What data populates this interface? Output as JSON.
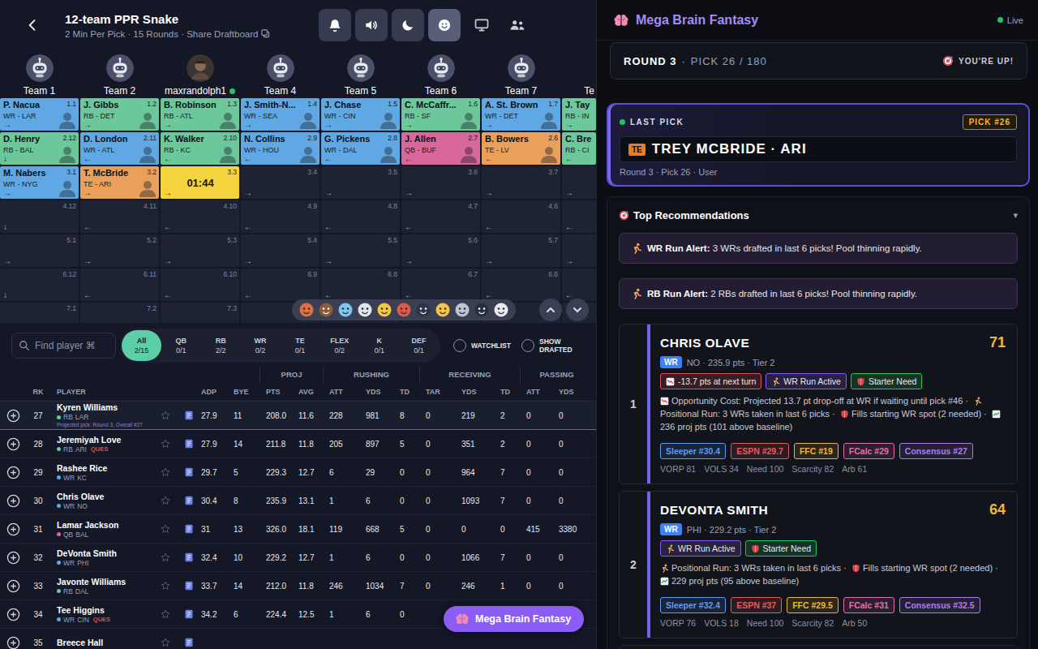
{
  "header": {
    "title": "12-team PPR Snake",
    "subtitle": "2 Min Per Pick · 15 Rounds · Share Draftboard"
  },
  "toolbar": [
    {
      "kind": "bell",
      "selected": false
    },
    {
      "kind": "speaker",
      "selected": false
    },
    {
      "kind": "moon",
      "selected": false
    },
    {
      "kind": "smile",
      "selected": true
    }
  ],
  "teams": [
    {
      "label": "Team 1",
      "kind": "bot"
    },
    {
      "label": "Team 2",
      "kind": "bot"
    },
    {
      "label": "maxrandolph1",
      "kind": "user",
      "online": true
    },
    {
      "label": "Team 4",
      "kind": "bot"
    },
    {
      "label": "Team 5",
      "kind": "bot"
    },
    {
      "label": "Team 6",
      "kind": "bot"
    },
    {
      "label": "Team 7",
      "kind": "bot"
    },
    {
      "label": "Te",
      "kind": "bot"
    }
  ],
  "board": {
    "rows": [
      [
        {
          "kind": "picked",
          "name": "P. Nacua",
          "pick": "1.1",
          "pos": "WR - LAR",
          "color": "#5fa8e3",
          "arrow": "→"
        },
        {
          "kind": "picked",
          "name": "J. Gibbs",
          "pick": "1.2",
          "pos": "RB - DET",
          "color": "#6cc89a",
          "arrow": "→"
        },
        {
          "kind": "picked",
          "name": "B. Robinson",
          "pick": "1.3",
          "pos": "RB - ATL",
          "color": "#6cc89a",
          "arrow": "→"
        },
        {
          "kind": "picked",
          "name": "J. Smith-N...",
          "pick": "1.4",
          "pos": "WR - SEA",
          "color": "#5fa8e3",
          "arrow": "→"
        },
        {
          "kind": "picked",
          "name": "J. Chase",
          "pick": "1.5",
          "pos": "WR - CIN",
          "color": "#5fa8e3",
          "arrow": "→"
        },
        {
          "kind": "picked",
          "name": "C. McCaffr...",
          "pick": "1.6",
          "pos": "RB - SF",
          "color": "#6cc89a",
          "arrow": "→"
        },
        {
          "kind": "picked",
          "name": "A. St. Brown",
          "pick": "1.7",
          "pos": "WR - DET",
          "color": "#5fa8e3",
          "arrow": "→"
        },
        {
          "kind": "picked",
          "name": "J. Tay",
          "pos": "RB - IN",
          "color": "#6cc89a",
          "arrow": "→"
        }
      ],
      [
        {
          "kind": "picked",
          "name": "D. Henry",
          "pick": "2.12",
          "pos": "RB - BAL",
          "color": "#6cc89a",
          "arrow": "↓"
        },
        {
          "kind": "picked",
          "name": "D. London",
          "pick": "2.11",
          "pos": "WR - ATL",
          "color": "#5fa8e3",
          "arrow": "←"
        },
        {
          "kind": "picked",
          "name": "K. Walker",
          "pick": "2.10",
          "pos": "RB - KC",
          "color": "#6cc89a",
          "arrow": "←"
        },
        {
          "kind": "picked",
          "name": "N. Collins",
          "pick": "2.9",
          "pos": "WR - HOU",
          "color": "#5fa8e3",
          "arrow": "←"
        },
        {
          "kind": "picked",
          "name": "G. Pickens",
          "pick": "2.8",
          "pos": "WR - DAL",
          "color": "#5fa8e3",
          "arrow": "←"
        },
        {
          "kind": "picked",
          "name": "J. Allen",
          "pick": "2.7",
          "pos": "QB - BUF",
          "color": "#d8679a",
          "arrow": "←"
        },
        {
          "kind": "picked",
          "name": "B. Bowers",
          "pick": "2.6",
          "pos": "TE - LV",
          "color": "#e9a05b",
          "arrow": "←"
        },
        {
          "kind": "picked",
          "name": "C. Bre",
          "pos": "RB - CI",
          "color": "#6cc89a",
          "arrow": "←"
        }
      ],
      [
        {
          "kind": "picked",
          "name": "M. Nabers",
          "pick": "3.1",
          "pos": "WR - NYG",
          "color": "#5fa8e3",
          "arrow": "→"
        },
        {
          "kind": "picked",
          "name": "T. McBride",
          "pick": "3.2",
          "pos": "TE - ARI",
          "color": "#e9a05b",
          "arrow": "→"
        },
        {
          "kind": "current",
          "pick": "3.3",
          "timer": "01:44",
          "arrow": "→"
        },
        {
          "kind": "empty",
          "pick": "3.4",
          "arrow": "→"
        },
        {
          "kind": "empty",
          "pick": "3.5",
          "arrow": "→"
        },
        {
          "kind": "empty",
          "pick": "3.6",
          "arrow": "→"
        },
        {
          "kind": "empty",
          "pick": "3.7",
          "arrow": "→"
        },
        {
          "kind": "empty",
          "arrow": "→"
        }
      ],
      [
        {
          "kind": "empty",
          "pick": "4.12",
          "arrow": "↓"
        },
        {
          "kind": "empty",
          "pick": "4.11",
          "arrow": "←"
        },
        {
          "kind": "empty",
          "pick": "4.10",
          "arrow": "←"
        },
        {
          "kind": "empty",
          "pick": "4.9",
          "arrow": "←"
        },
        {
          "kind": "empty",
          "pick": "4.8",
          "arrow": "←"
        },
        {
          "kind": "empty",
          "pick": "4.7",
          "arrow": "←"
        },
        {
          "kind": "empty",
          "pick": "4.6",
          "arrow": "←"
        },
        {
          "kind": "empty",
          "arrow": "←"
        }
      ],
      [
        {
          "kind": "empty",
          "pick": "5.1",
          "arrow": "→"
        },
        {
          "kind": "empty",
          "pick": "5.2",
          "arrow": "→"
        },
        {
          "kind": "empty",
          "pick": "5.3",
          "arrow": "→"
        },
        {
          "kind": "empty",
          "pick": "5.4",
          "arrow": "→"
        },
        {
          "kind": "empty",
          "pick": "5.5",
          "arrow": "→"
        },
        {
          "kind": "empty",
          "pick": "5.6",
          "arrow": "→"
        },
        {
          "kind": "empty",
          "pick": "5.7",
          "arrow": "→"
        },
        {
          "kind": "empty",
          "arrow": "→"
        }
      ],
      [
        {
          "kind": "empty",
          "pick": "6.12",
          "arrow": "↓"
        },
        {
          "kind": "empty",
          "pick": "6.11",
          "arrow": "←"
        },
        {
          "kind": "empty",
          "pick": "6.10",
          "arrow": "←"
        },
        {
          "kind": "empty",
          "pick": "6.9",
          "arrow": "←"
        },
        {
          "kind": "empty",
          "pick": "6.8",
          "arrow": "←"
        },
        {
          "kind": "empty",
          "pick": "6.7",
          "arrow": "←"
        },
        {
          "kind": "empty",
          "pick": "6.6",
          "arrow": "←"
        },
        {
          "kind": "empty",
          "arrow": "←"
        }
      ],
      [
        {
          "kind": "empty",
          "pick": "7.1"
        },
        {
          "kind": "empty",
          "pick": "7.2"
        },
        {
          "kind": "empty",
          "pick": "7.3"
        },
        {
          "kind": "empty"
        },
        {
          "kind": "empty"
        },
        {
          "kind": "empty"
        },
        {
          "kind": "empty"
        },
        {
          "kind": "empty"
        }
      ]
    ]
  },
  "filters": {
    "search": {
      "placeholder": "Find player ⌘"
    },
    "positions": [
      {
        "label": "All",
        "count": "2/15",
        "selected": true
      },
      {
        "label": "QB",
        "count": "0/1",
        "selected": false
      },
      {
        "label": "RB",
        "count": "2/2",
        "selected": false
      },
      {
        "label": "WR",
        "count": "0/2",
        "selected": false
      },
      {
        "label": "TE",
        "count": "0/1",
        "selected": false
      },
      {
        "label": "FLEX",
        "count": "0/2",
        "selected": false
      },
      {
        "label": "K",
        "count": "0/1",
        "selected": false
      },
      {
        "label": "DEF",
        "count": "0/1",
        "selected": false
      }
    ],
    "toggles": [
      {
        "label": "WATCHLIST",
        "checked": false
      },
      {
        "label": "SHOW DRAFTED",
        "checked": false
      }
    ]
  },
  "table": {
    "groups": [
      "PROJ",
      "RUSHING",
      "RECEIVING",
      "PASSING"
    ],
    "columns": [
      "RK",
      "PLAYER",
      "ADP",
      "BYE",
      "PTS",
      "AVG",
      "ATT",
      "YDS",
      "TD",
      "TAR",
      "YDS",
      "TD",
      "ATT",
      "YDS"
    ],
    "rows": [
      {
        "rank": "27",
        "name": "Kyren Williams",
        "pos": "RB",
        "team": "LAR",
        "color": "#6cc89a",
        "note": "Projected pick: Round 3, Overall #27",
        "highlighted": true,
        "watched": false,
        "values": [
          "27.9",
          "11",
          "208.0",
          "11.6",
          "228",
          "981",
          "8",
          "0",
          "219",
          "2",
          "0",
          "0"
        ]
      },
      {
        "rank": "28",
        "name": "Jeremiyah Love",
        "pos": "RB",
        "team": "ARI",
        "status": "QUES",
        "color": "#6cc89a",
        "highlighted": false,
        "watched": false,
        "values": [
          "27.9",
          "14",
          "211.8",
          "11.8",
          "205",
          "897",
          "5",
          "0",
          "351",
          "2",
          "0",
          "0"
        ]
      },
      {
        "rank": "29",
        "name": "Rashee Rice",
        "pos": "WR",
        "team": "KC",
        "color": "#5fa8e3",
        "highlighted": false,
        "watched": false,
        "values": [
          "29.7",
          "5",
          "229.3",
          "12.7",
          "6",
          "29",
          "0",
          "0",
          "964",
          "7",
          "0",
          "0"
        ]
      },
      {
        "rank": "30",
        "name": "Chris Olave",
        "pos": "WR",
        "team": "NO",
        "color": "#5fa8e3",
        "highlighted": false,
        "watched": false,
        "values": [
          "30.4",
          "8",
          "235.9",
          "13.1",
          "1",
          "6",
          "0",
          "0",
          "1093",
          "7",
          "0",
          "0"
        ]
      },
      {
        "rank": "31",
        "name": "Lamar Jackson",
        "pos": "QB",
        "team": "BAL",
        "color": "#d8679a",
        "highlighted": false,
        "watched": false,
        "values": [
          "31",
          "13",
          "326.0",
          "18.1",
          "119",
          "668",
          "5",
          "0",
          "0",
          "0",
          "415",
          "3380"
        ]
      },
      {
        "rank": "32",
        "name": "DeVonta Smith",
        "pos": "WR",
        "team": "PHI",
        "color": "#5fa8e3",
        "highlighted": false,
        "watched": false,
        "values": [
          "32.4",
          "10",
          "229.2",
          "12.7",
          "1",
          "6",
          "0",
          "0",
          "1066",
          "7",
          "0",
          "0"
        ]
      },
      {
        "rank": "33",
        "name": "Javonte Williams",
        "pos": "RB",
        "team": "DAL",
        "color": "#6cc89a",
        "highlighted": false,
        "watched": false,
        "values": [
          "33.7",
          "14",
          "212.0",
          "11.8",
          "246",
          "1034",
          "7",
          "0",
          "246",
          "1",
          "0",
          "0"
        ]
      },
      {
        "rank": "34",
        "name": "Tee Higgins",
        "pos": "WR",
        "team": "CIN",
        "status": "QUES",
        "color": "#5fa8e3",
        "highlighted": false,
        "watched": false,
        "values": [
          "34.2",
          "6",
          "224.4",
          "12.5",
          "1",
          "6",
          "0"
        ]
      },
      {
        "rank": "35",
        "name": "Breece Hall",
        "highlighted": false,
        "watched": false,
        "values": []
      }
    ]
  },
  "fab": {
    "label": "Mega Brain Fantasy"
  },
  "assistant": {
    "title": "Mega Brain Fantasy",
    "live": "Live",
    "round": "ROUND 3",
    "sep": "·",
    "pick": "PICK 26 / 180",
    "status": "YOU'RE UP!",
    "last_pick": {
      "heading": "LAST PICK",
      "badge": "PICK #26",
      "pos": "TE",
      "player": "TREY MCBRIDE · ARI",
      "detail": "Round 3 · Pick 26 · User"
    },
    "recs": {
      "title": "Top Recommendations",
      "toggle": "▾",
      "alerts": [
        {
          "label": "WR Run Alert:",
          "text": "3 WRs drafted in last 6 picks! Pool thinning rapidly."
        },
        {
          "label": "RB Run Alert:",
          "text": "2 RBs drafted in last 6 picks! Pool thinning rapidly."
        }
      ],
      "cards": [
        {
          "rank": "1",
          "name": "CHRIS OLAVE",
          "score": "71",
          "pos": "WR",
          "meta": "NO · 235.9 pts · Tier 2",
          "tags": [
            {
              "kind": "drop",
              "text": "-13.7 pts at next turn",
              "color": "#e0505a"
            },
            {
              "kind": "run",
              "text": "WR Run Active",
              "color": "#8b5cf6"
            },
            {
              "kind": "shield",
              "text": "Starter Need",
              "color": "#22c55e"
            }
          ],
          "reasons": [
            {
              "kind": "drop",
              "text": "Opportunity Cost: Projected 13.7 pt drop-off at WR if waiting until pick #46 ·"
            },
            {
              "kind": "run",
              "text": "Positional Run: 3 WRs taken in last 6 picks ·"
            },
            {
              "kind": "shield",
              "text": "Fills starting WR spot (2 needed) ·"
            },
            {
              "kind": "chart",
              "text": "236 proj pts (101 above baseline)"
            }
          ],
          "ranks": [
            {
              "text": "Sleeper #30.4",
              "color": "#5b9cf5"
            },
            {
              "text": "ESPN #29.7",
              "color": "#e85a5a"
            },
            {
              "text": "FFC #19",
              "color": "#e8b931"
            },
            {
              "text": "FCalc #29",
              "color": "#e070b0"
            },
            {
              "text": "Consensus #27",
              "color": "#b07ce8"
            }
          ],
          "stats": [
            "VORP 81",
            "VOLS 34",
            "Need 100",
            "Scarcity 82",
            "Arb 61"
          ]
        },
        {
          "rank": "2",
          "name": "DEVONTA SMITH",
          "score": "64",
          "pos": "WR",
          "meta": "PHI · 229.2 pts · Tier 2",
          "tags": [
            {
              "kind": "run",
              "text": "WR Run Active",
              "color": "#8b5cf6"
            },
            {
              "kind": "shield",
              "text": "Starter Need",
              "color": "#22c55e"
            }
          ],
          "reasons": [
            {
              "kind": "run",
              "text": "Positional Run: 3 WRs taken in last 6 picks ·"
            },
            {
              "kind": "shield",
              "text": "Fills starting WR spot (2 needed) ·"
            },
            {
              "kind": "chart",
              "text": "229 proj pts (95 above baseline)"
            }
          ],
          "ranks": [
            {
              "text": "Sleeper #32.4",
              "color": "#5b9cf5"
            },
            {
              "text": "ESPN #37",
              "color": "#e85a5a"
            },
            {
              "text": "FFC #29.5",
              "color": "#e8b931"
            },
            {
              "text": "FCalc #31",
              "color": "#e070b0"
            },
            {
              "text": "Consensus #32.5",
              "color": "#b07ce8"
            }
          ],
          "stats": [
            "VORP 76",
            "VOLS 18",
            "Need 100",
            "Scarcity 82",
            "Arb 50"
          ]
        }
      ]
    }
  }
}
